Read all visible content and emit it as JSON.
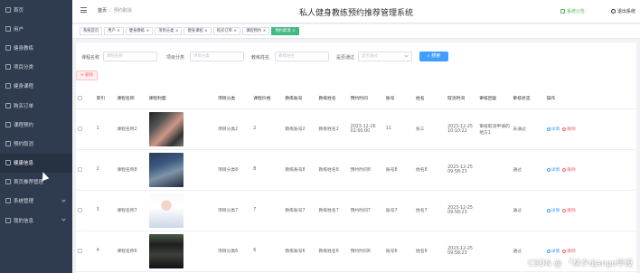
{
  "colors": {
    "sidebar_bg": "#2f3c4f",
    "accent_green": "#42b983",
    "primary_blue": "#409eff",
    "danger_red": "#f56c6c"
  },
  "sidebar": {
    "items": [
      {
        "label": "首页",
        "icon": "home-icon"
      },
      {
        "label": "用户",
        "icon": "user-icon"
      },
      {
        "label": "健身教练",
        "icon": "coach-icon"
      },
      {
        "label": "项目分类",
        "icon": "category-icon"
      },
      {
        "label": "健身课程",
        "icon": "course-icon"
      },
      {
        "label": "购买订单",
        "icon": "order-icon"
      },
      {
        "label": "课程预约",
        "icon": "booking-icon"
      },
      {
        "label": "预约取消",
        "icon": "cancel-icon"
      },
      {
        "label": "健康信息",
        "icon": "health-icon"
      },
      {
        "label": "首页推荐管理",
        "icon": "recommend-icon"
      },
      {
        "label": "系统管理",
        "icon": "settings-icon"
      },
      {
        "label": "我的信息",
        "icon": "profile-icon"
      }
    ],
    "active_index": 8
  },
  "header": {
    "breadcrumb_home": "首页",
    "breadcrumb_sep": "/",
    "breadcrumb_current": "预约取消",
    "title": "私人健身教练预约推荐管理系统",
    "system_notice": "系统公告",
    "logout": "退出系统"
  },
  "tabs": [
    {
      "label": "系统首页",
      "closable": false
    },
    {
      "label": "用户",
      "closable": true
    },
    {
      "label": "健身教练",
      "closable": true
    },
    {
      "label": "项目分类",
      "closable": true
    },
    {
      "label": "健身课程",
      "closable": true
    },
    {
      "label": "购买订单",
      "closable": true
    },
    {
      "label": "课程预约",
      "closable": true
    },
    {
      "label": "预约取消",
      "closable": true,
      "active": true
    }
  ],
  "search": {
    "course_name_label": "课程名称",
    "course_name_placeholder": "课程名称",
    "category_label": "项目分类",
    "category_placeholder": "项目分类",
    "coach_name_label": "教练姓名",
    "coach_name_placeholder": "教练姓名",
    "approved_label": "是否通过",
    "approved_placeholder": "是否通过",
    "search_button": "搜索"
  },
  "delete_button": "删除",
  "table": {
    "headers": [
      "索引",
      "课程名称",
      "课程封面",
      "项目分类",
      "课程价格",
      "教练账号",
      "教练姓名",
      "预约时间",
      "账号",
      "姓名",
      "取消时间",
      "审核回复",
      "审核状态",
      "操作"
    ],
    "detail_label": "详情",
    "delete_label": "删除",
    "rows": [
      {
        "index": "1",
        "course": "课程名称2",
        "category": "项目分类2",
        "price": "2",
        "coach_account": "教练账号2",
        "coach_name": "教练姓名2",
        "booking_time": "2023-12-26 02:00:00",
        "account": "11",
        "name": "张三",
        "cancel_time": "2023-12-25 10:10:22",
        "reply": "审核取消申请的地方1",
        "status": "未通过"
      },
      {
        "index": "2",
        "course": "课程名称8",
        "category": "项目分类8",
        "price": "8",
        "coach_account": "教练账号8",
        "coach_name": "教练姓名8",
        "booking_time": "预约时间8",
        "account": "账号8",
        "name": "姓名8",
        "cancel_time": "2023-12-25 09:58:23",
        "reply": "",
        "status": "通过"
      },
      {
        "index": "3",
        "course": "课程名称7",
        "category": "项目分类7",
        "price": "7",
        "coach_account": "教练账号7",
        "coach_name": "教练姓名7",
        "booking_time": "预约时间7",
        "account": "账号7",
        "name": "姓名7",
        "cancel_time": "2023-12-25 09:58:23",
        "reply": "",
        "status": "通过"
      },
      {
        "index": "4",
        "course": "课程名称6",
        "category": "项目分类6",
        "price": "6",
        "coach_account": "教练账号6",
        "coach_name": "教练姓名6",
        "booking_time": "预约时间6",
        "account": "账号6",
        "name": "姓名6",
        "cancel_time": "2023-12-25 09:58:23",
        "reply": "",
        "status": "通过"
      }
    ]
  },
  "watermark": "CSDN @ 「林夕django毕设"
}
